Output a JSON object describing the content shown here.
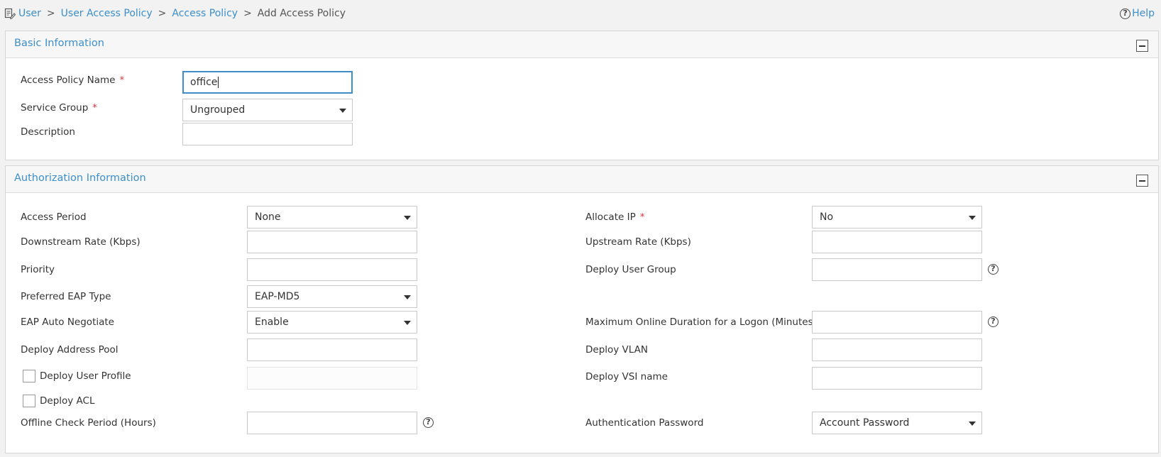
{
  "breadcrumb": {
    "items": [
      "User",
      "User Access Policy",
      "Access Policy"
    ],
    "current": "Add Access Policy",
    "separator": ">",
    "icon": "policy-document-icon"
  },
  "help_label": "Help",
  "basic": {
    "title": "Basic Information",
    "policy_name_label": "Access Policy Name",
    "policy_name_value": "office",
    "service_group_label": "Service Group",
    "service_group_value": "Ungrouped",
    "description_label": "Description",
    "description_value": ""
  },
  "auth": {
    "title": "Authorization Information",
    "access_period_label": "Access Period",
    "access_period_value": "None",
    "downstream_label": "Downstream Rate (Kbps)",
    "priority_label": "Priority",
    "eap_type_label": "Preferred EAP Type",
    "eap_type_value": "EAP-MD5",
    "eap_neg_label": "EAP Auto Negotiate",
    "eap_neg_value": "Enable",
    "address_pool_label": "Deploy Address Pool",
    "user_profile_label": "Deploy User Profile",
    "acl_label": "Deploy ACL",
    "offline_label": "Offline Check Period (Hours)",
    "allocate_ip_label": "Allocate IP",
    "allocate_ip_value": "No",
    "upstream_label": "Upstream Rate (Kbps)",
    "user_group_label": "Deploy User Group",
    "max_online_label": "Maximum Online Duration for a Logon (Minutes)",
    "vlan_label": "Deploy VLAN",
    "vsi_label": "Deploy VSI name",
    "auth_password_label": "Authentication Password",
    "auth_password_value": "Account Password"
  },
  "required_mark": "*",
  "help_glyph": "?",
  "colors": {
    "link": "#3d8ec9",
    "required": "#d9363e",
    "focus_border": "#3d8ec9"
  }
}
